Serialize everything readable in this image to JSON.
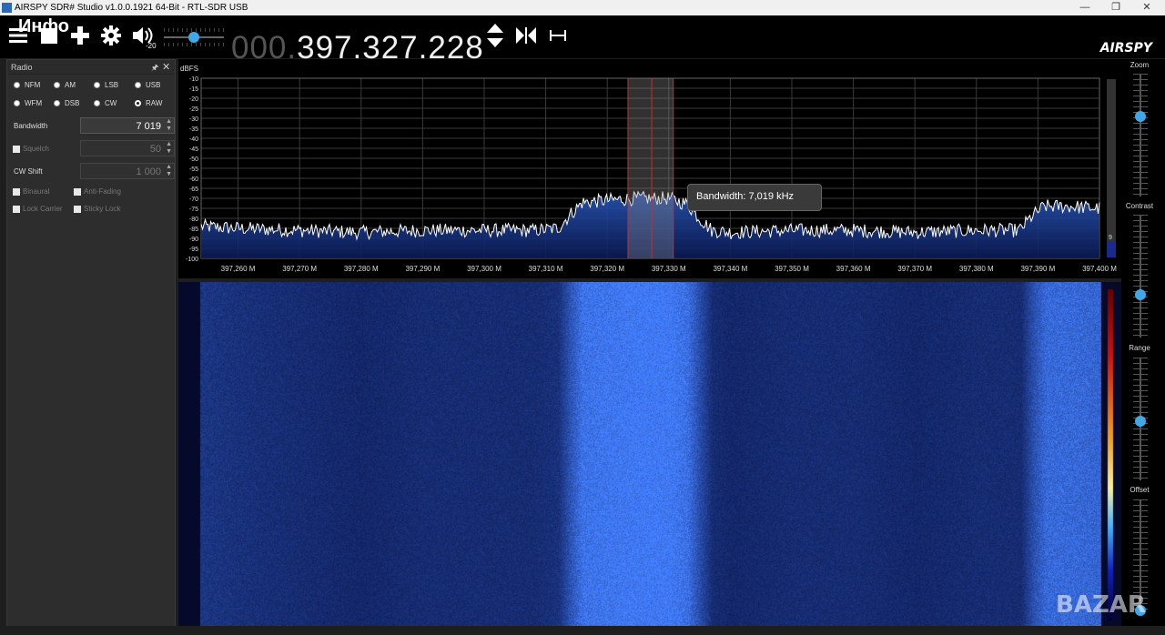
{
  "window": {
    "title": "AIRSPY SDR# Studio v1.0.0.1921 64-Bit - RTL-SDR USB",
    "minimize": "—",
    "maximize": "❐",
    "close": "✕"
  },
  "toolbar": {
    "overlay_text": "Инфо",
    "volume_level": "-20",
    "volume_fraction": 0.5,
    "frequency_prefix": "000.",
    "frequency_main": "397.327.228",
    "logo": "AIRSPY"
  },
  "radio_panel": {
    "title": "Radio",
    "pin": "🖈",
    "close": "✕",
    "modes": [
      {
        "label": "NFM",
        "selected": false
      },
      {
        "label": "AM",
        "selected": false
      },
      {
        "label": "LSB",
        "selected": false
      },
      {
        "label": "USB",
        "selected": false
      },
      {
        "label": "WFM",
        "selected": false
      },
      {
        "label": "DSB",
        "selected": false
      },
      {
        "label": "CW",
        "selected": false
      },
      {
        "label": "RAW",
        "selected": true
      }
    ],
    "bandwidth_label": "Bandwidth",
    "bandwidth_value": "7 019",
    "squelch_label": "Squelch",
    "squelch_value": "50",
    "cwshift_label": "CW Shift",
    "cwshift_value": "1 000",
    "binaural_label": "Binaural",
    "antifading_label": "Anti-Fading",
    "lockcarrier_label": "Lock Carrier",
    "stickylock_label": "Sticky Lock"
  },
  "spectrum": {
    "ylabel": "dBFS",
    "tooltip": "Bandwidth: 7,019 kHz",
    "scroll_value": "9",
    "colors": {
      "trace": "#ffffff",
      "fill": "#1a3a8a",
      "grid": "#3a3a3a",
      "filter": "#c03030"
    }
  },
  "right_panel": {
    "zoom_label": "Zoom",
    "contrast_label": "Contrast",
    "range_label": "Range",
    "offset_label": "Offset",
    "zoom_level": 0.65,
    "contrast_level": 0.35,
    "range_level": 0.48,
    "offset_level": 0.0
  },
  "watermark": "BAZAR",
  "chart_data": {
    "type": "line",
    "title": "",
    "ylabel": "dBFS",
    "xlabel": "",
    "ylim": [
      -100,
      -10
    ],
    "xlim": [
      397254000,
      397400000
    ],
    "y_ticks": [
      "-10",
      "-15",
      "-20",
      "-25",
      "-30",
      "-35",
      "-40",
      "-45",
      "-50",
      "-55",
      "-60",
      "-65",
      "-70",
      "-75",
      "-80",
      "-85",
      "-90",
      "-95",
      "-100"
    ],
    "x_ticks": [
      "397,260 M",
      "397,270 M",
      "397,280 M",
      "397,290 M",
      "397,300 M",
      "397,310 M",
      "397,320 M",
      "397,330 M",
      "397,340 M",
      "397,350 M",
      "397,360 M",
      "397,370 M",
      "397,380 M",
      "397,390 M",
      "397,400 M"
    ],
    "x_tick_values": [
      397260000,
      397270000,
      397280000,
      397290000,
      397300000,
      397310000,
      397320000,
      397330000,
      397340000,
      397350000,
      397360000,
      397370000,
      397380000,
      397390000,
      397400000
    ],
    "center_frequency": 397327228,
    "filter_bandwidth_hz": 7019,
    "series": [
      {
        "x": [
          397254000,
          397260000,
          397270000,
          397280000,
          397290000,
          397300000,
          397308000,
          397312000,
          397314000,
          397316000,
          397320000,
          397325000,
          397330000,
          397333000,
          397335000,
          397337000,
          397340000,
          397350000,
          397360000,
          397370000,
          397380000,
          397387000,
          397389000,
          397391000,
          397395000,
          397400000
        ],
        "values": [
          -84,
          -85,
          -86,
          -87,
          -86,
          -86,
          -86,
          -85,
          -78,
          -72,
          -71,
          -70,
          -70,
          -73,
          -80,
          -86,
          -87,
          -86,
          -86,
          -87,
          -86,
          -86,
          -79,
          -74,
          -74,
          -75
        ]
      }
    ]
  }
}
